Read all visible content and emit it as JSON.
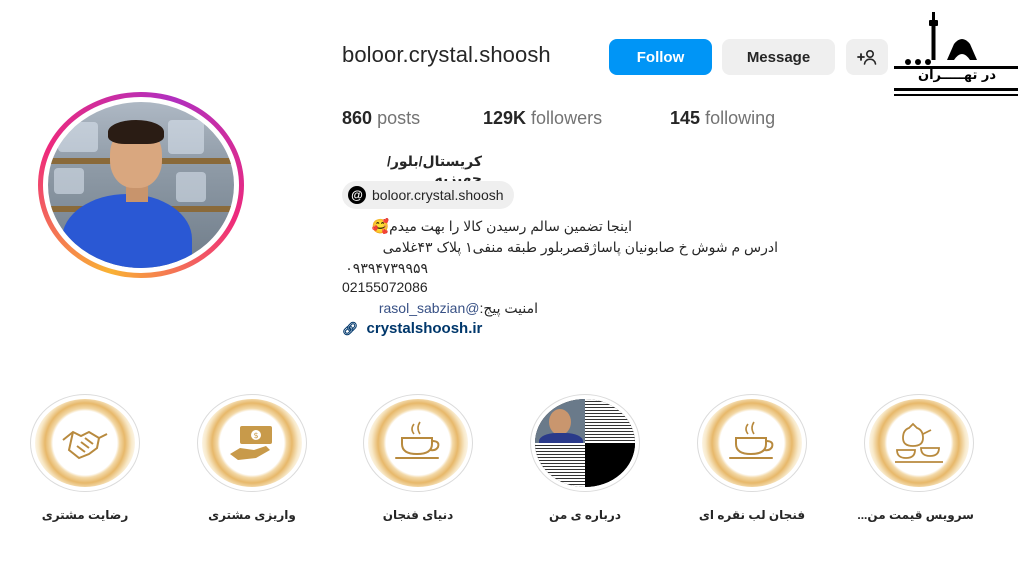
{
  "profile": {
    "username": "boloor.crystal.shoosh",
    "follow_label": "Follow",
    "message_label": "Message",
    "add_user_icon": "+☺"
  },
  "stats": {
    "posts_count": "860",
    "posts_label": "posts",
    "followers_count": "129K",
    "followers_label": "followers",
    "following_count": "145",
    "following_label": "following"
  },
  "bio": {
    "name": "کریستال/بلور/جهیزیه",
    "threads_handle": "boloor.crystal.shoosh",
    "line1": "اینجا تضمین سالم رسیدن کالا را بهت میدم🥰",
    "line2": "ادرس م شوش خ صابونیان پاساژقصربلور طبقه منفی۱ پلاک ۴۳غلامی",
    "line3": "۰۹۳۹۴۷۳۹۹۵۹",
    "line4": "02155072086",
    "line5_prefix": "امنیت پیج:",
    "line5_mention": "@rasol_sabzian",
    "website": "crystalshoosh.ir"
  },
  "watermark": {
    "text": "در تهـــــران"
  },
  "highlights": [
    {
      "label": "رضایت مشتری",
      "icon": "handshake-icon"
    },
    {
      "label": "واریزی مشتری",
      "icon": "money-hand-icon"
    },
    {
      "label": "دنیای فنجان",
      "icon": "teacup-icon"
    },
    {
      "label": "درباره ی من",
      "icon": "photo"
    },
    {
      "label": "فنجان لب نقره ای",
      "icon": "teacup-icon"
    },
    {
      "label": "سرویس قیمت من...",
      "icon": "tea-set-icon"
    }
  ],
  "colors": {
    "follow_button": "#0095f6",
    "secondary_button": "#efefef",
    "link": "#00376b",
    "highlight_gold": "#e7b86a"
  }
}
